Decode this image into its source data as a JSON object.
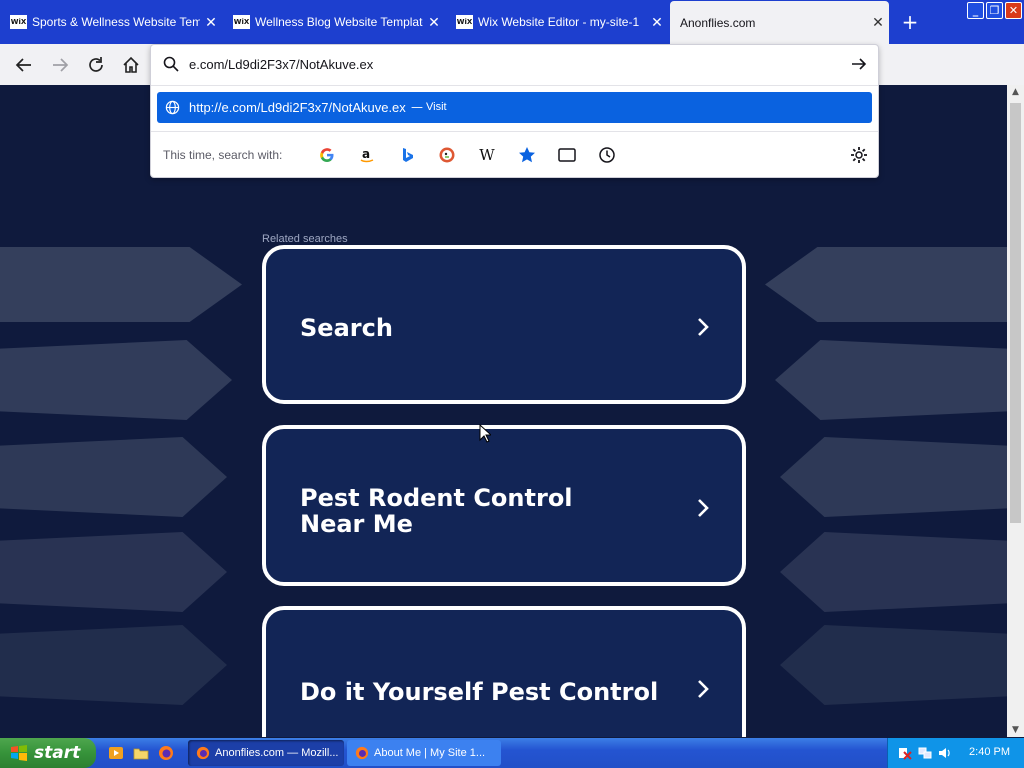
{
  "browser": {
    "tabs": [
      {
        "label": "Sports & Wellness Website Templat",
        "favicon": "WiX",
        "active": false
      },
      {
        "label": "Wellness Blog Website Template | W",
        "favicon": "WiX",
        "active": false
      },
      {
        "label": "Wix Website Editor - my-site-1",
        "favicon": "WiX",
        "active": false
      },
      {
        "label": "Anonflies.com",
        "favicon": "",
        "active": true
      }
    ],
    "new_tab_symbol": "+",
    "close_symbol": "✕",
    "window_buttons": {
      "minimize": "_",
      "restore": "❐",
      "close": "✕"
    }
  },
  "urlbar": {
    "value": "e.com/Ld9di2F3x7/NotAkuve.ex",
    "suggestion_url": "http://e.com/Ld9di2F3x7/NotAkuve.ex",
    "suggestion_separator": "—",
    "suggestion_action": "Visit",
    "search_with_label": "This time, search with:",
    "engines": [
      "google-icon",
      "amazon-icon",
      "bing-icon",
      "duckduckgo-icon",
      "wikipedia-icon",
      "bookmarks-icon",
      "tabs-icon",
      "history-icon"
    ],
    "wikipedia_glyph": "W"
  },
  "page": {
    "related_label": "Related searches",
    "cards": [
      {
        "label": "Search"
      },
      {
        "label": "Pest Rodent Control Near Me"
      },
      {
        "label": "Do it Yourself Pest Control"
      }
    ],
    "colors": {
      "background": "#0f1a3d",
      "card": "#122556",
      "card_border": "#ffffff"
    }
  },
  "taskbar": {
    "start_label": "start",
    "items": [
      {
        "label": "Anonflies.com — Mozill...",
        "active": true
      },
      {
        "label": "About Me | My Site 1...",
        "active": false
      }
    ],
    "clock": "2:40 PM"
  }
}
